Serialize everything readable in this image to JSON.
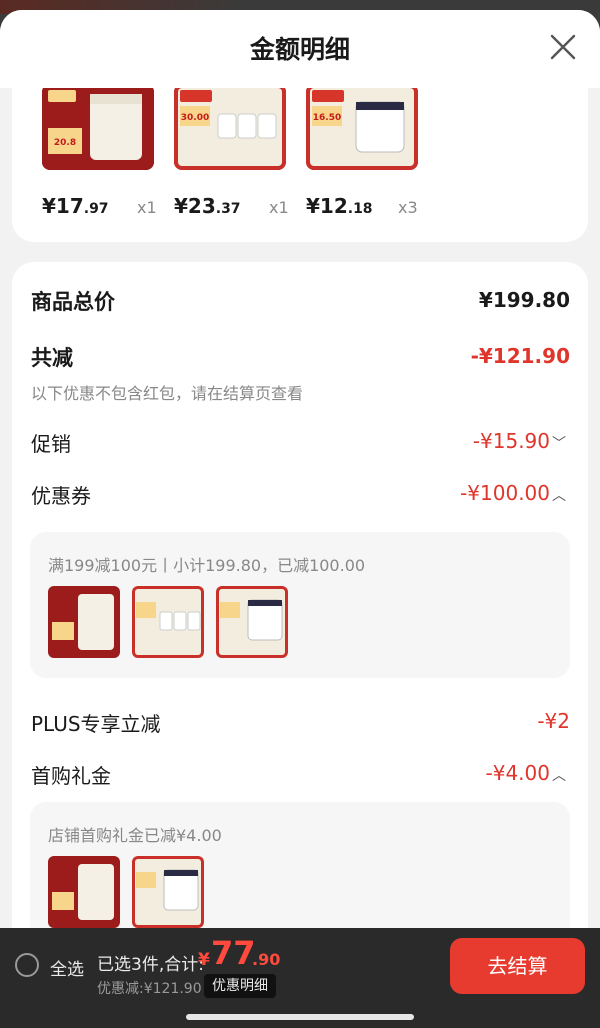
{
  "backdrop": {
    "text": ""
  },
  "sheet": {
    "title": "金额明细"
  },
  "products": [
    {
      "price_int": "¥17",
      "price_dec": ".97",
      "qty": "x1"
    },
    {
      "price_int": "¥23",
      "price_dec": ".37",
      "qty": "x1"
    },
    {
      "price_int": "¥12",
      "price_dec": ".18",
      "qty": "x3"
    }
  ],
  "summary": {
    "subtotal_label": "商品总价",
    "subtotal_value": "¥199.80",
    "reduce_label": "共减",
    "reduce_value": "-¥121.90",
    "reduce_hint": "以下优惠不包含红包，请在结算页查看",
    "promo_label": "促销",
    "promo_value": "-¥15.90",
    "coupon_label": "优惠券",
    "coupon_value": "-¥100.00",
    "coupon_detail": "满199减100元丨小计199.80，已减100.00",
    "plus_label": "PLUS专享立减",
    "plus_value": "-¥2",
    "first_label": "首购礼金",
    "first_value": "-¥4.00",
    "first_detail": "店铺首购礼金已减¥4.00"
  },
  "bottom": {
    "select_all": "全选",
    "selected_text": "已选3件,合计:",
    "total_symbol": "¥",
    "total_int": "77",
    "total_dec": ".90",
    "discount_text": "优惠减:¥121.90",
    "detail_button": "优惠明细",
    "checkout_button": "去结算"
  },
  "colors": {
    "accent": "#e83b30",
    "price_red": "#e0352b"
  }
}
